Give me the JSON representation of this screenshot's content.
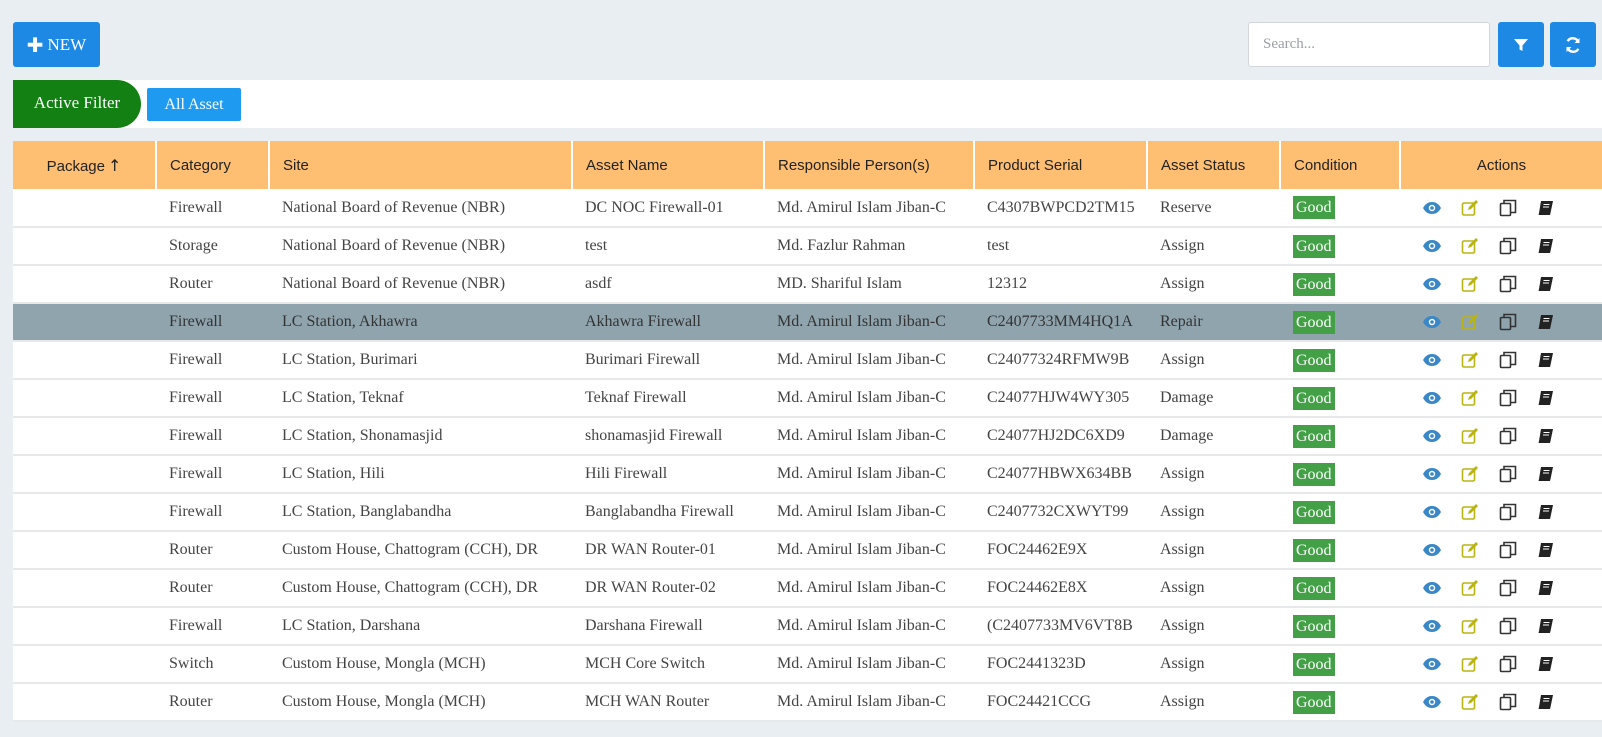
{
  "toolbar": {
    "new_label": "NEW",
    "search_placeholder": "Search...",
    "filter_icon": "filter-icon",
    "refresh_icon": "refresh-icon"
  },
  "filters": {
    "active_filter_label": "Active Filter",
    "all_asset_label": "All Asset"
  },
  "table": {
    "headers": {
      "package": "Package",
      "category": "Category",
      "site": "Site",
      "asset_name": "Asset Name",
      "responsible": "Responsible Person(s)",
      "serial": "Product Serial",
      "status": "Asset Status",
      "condition": "Condition",
      "actions": "Actions"
    },
    "rows": [
      {
        "package": "",
        "category": "Firewall",
        "site": "National Board of Revenue (NBR)",
        "asset_name": "DC NOC Firewall-01",
        "responsible": "Md. Amirul Islam Jiban-C",
        "serial": "C4307BWPCD2TM15",
        "status": "Reserve",
        "condition": "Good"
      },
      {
        "package": "",
        "category": "Storage",
        "site": "National Board of Revenue (NBR)",
        "asset_name": "test",
        "responsible": "Md. Fazlur Rahman",
        "serial": "test",
        "status": "Assign",
        "condition": "Good"
      },
      {
        "package": "",
        "category": "Router",
        "site": "National Board of Revenue (NBR)",
        "asset_name": "asdf",
        "responsible": "MD. Shariful Islam",
        "serial": "12312",
        "status": "Assign",
        "condition": "Good"
      },
      {
        "package": "",
        "category": "Firewall",
        "site": "LC Station, Akhawra",
        "asset_name": "Akhawra Firewall",
        "responsible": "Md. Amirul Islam Jiban-C",
        "serial": "C2407733MM4HQ1A",
        "status": "Repair",
        "condition": "Good"
      },
      {
        "package": "",
        "category": "Firewall",
        "site": "LC Station, Burimari",
        "asset_name": "Burimari Firewall",
        "responsible": "Md. Amirul Islam Jiban-C",
        "serial": "C24077324RFMW9B",
        "status": "Assign",
        "condition": "Good"
      },
      {
        "package": "",
        "category": "Firewall",
        "site": "LC Station, Teknaf",
        "asset_name": "Teknaf Firewall",
        "responsible": "Md. Amirul Islam Jiban-C",
        "serial": "C24077HJW4WY305",
        "status": "Damage",
        "condition": "Good"
      },
      {
        "package": "",
        "category": "Firewall",
        "site": "LC Station, Shonamasjid",
        "asset_name": "shonamasjid Firewall",
        "responsible": "Md. Amirul Islam Jiban-C",
        "serial": "C24077HJ2DC6XD9",
        "status": "Damage",
        "condition": "Good"
      },
      {
        "package": "",
        "category": "Firewall",
        "site": "LC Station, Hili",
        "asset_name": "Hili Firewall",
        "responsible": "Md. Amirul Islam Jiban-C",
        "serial": "C24077HBWX634BB",
        "status": "Assign",
        "condition": "Good"
      },
      {
        "package": "",
        "category": "Firewall",
        "site": "LC Station, Banglabandha",
        "asset_name": "Banglabandha Firewall",
        "responsible": "Md. Amirul Islam Jiban-C",
        "serial": "C2407732CXWYT99",
        "status": "Assign",
        "condition": "Good"
      },
      {
        "package": "",
        "category": "Router",
        "site": "Custom House, Chattogram (CCH), DR",
        "asset_name": "DR WAN Router-01",
        "responsible": "Md. Amirul Islam Jiban-C",
        "serial": "FOC24462E9X",
        "status": "Assign",
        "condition": "Good"
      },
      {
        "package": "",
        "category": "Router",
        "site": "Custom House, Chattogram (CCH), DR",
        "asset_name": "DR WAN Router-02",
        "responsible": "Md. Amirul Islam Jiban-C",
        "serial": "FOC24462E8X",
        "status": "Assign",
        "condition": "Good"
      },
      {
        "package": "",
        "category": "Firewall",
        "site": "LC Station, Darshana",
        "asset_name": "Darshana Firewall",
        "responsible": "Md. Amirul Islam Jiban-C",
        "serial": "(C2407733MV6VT8B",
        "status": "Assign",
        "condition": "Good"
      },
      {
        "package": "",
        "category": "Switch",
        "site": "Custom House, Mongla (MCH)",
        "asset_name": "MCH Core Switch",
        "responsible": "Md. Amirul Islam Jiban-C",
        "serial": "FOC2441323D",
        "status": "Assign",
        "condition": "Good"
      },
      {
        "package": "",
        "category": "Router",
        "site": "Custom House, Mongla (MCH)",
        "asset_name": "MCH WAN Router",
        "responsible": "Md. Amirul Islam Jiban-C",
        "serial": "FOC24421CCG",
        "status": "Assign",
        "condition": "Good"
      }
    ],
    "selected_row_index": 3
  },
  "colors": {
    "primary": "#1e88e5",
    "active_filter": "#128012",
    "header_bg": "#ffbf72",
    "selected_row": "#90a4ae",
    "good_badge": "#43a047",
    "view_icon": "#3a87c8",
    "edit_icon": "#b8b414"
  },
  "row_actions": [
    "view-icon",
    "edit-icon",
    "copy-icon",
    "book-icon"
  ]
}
